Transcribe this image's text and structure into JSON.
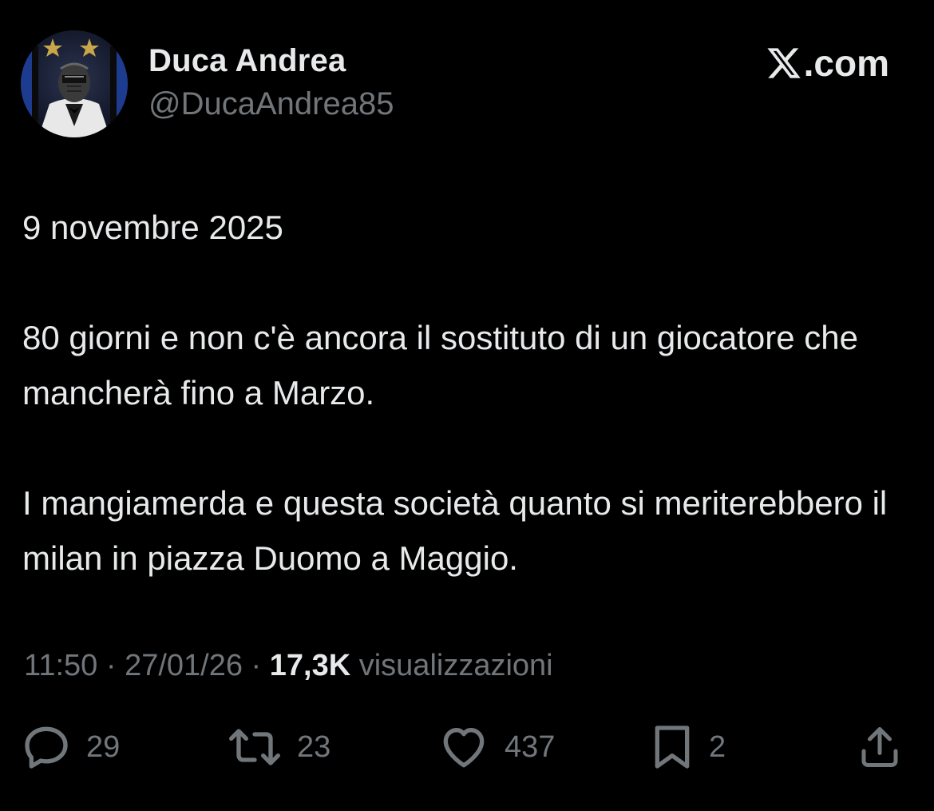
{
  "author": {
    "name": "Duca Andrea",
    "handle": "@DucaAndrea85",
    "avatar_icon": "profile-avatar"
  },
  "site": {
    "logo_text": ".com",
    "logo_icon": "x-logo-icon"
  },
  "tweet": {
    "paragraphs": [
      "9 novembre 2025",
      "80 giorni e non c'è ancora il sostituto di un giocatore che mancherà fino a Marzo.",
      "I mangiamerda e questa società quanto si meriterebbero il milan in piazza Duomo a Maggio."
    ]
  },
  "meta": {
    "time": "11:50",
    "date": "27/01/26",
    "separator": " · ",
    "views_count": "17,3K",
    "views_label": "visualizzazioni"
  },
  "actions": {
    "reply": {
      "icon": "reply-icon",
      "count": "29"
    },
    "retweet": {
      "icon": "retweet-icon",
      "count": "23"
    },
    "like": {
      "icon": "heart-icon",
      "count": "437"
    },
    "bookmark": {
      "icon": "bookmark-icon",
      "count": "2"
    },
    "share": {
      "icon": "share-icon"
    }
  },
  "colors": {
    "background": "#000000",
    "primary_text": "#e7e9ea",
    "secondary_text": "#71767b"
  }
}
